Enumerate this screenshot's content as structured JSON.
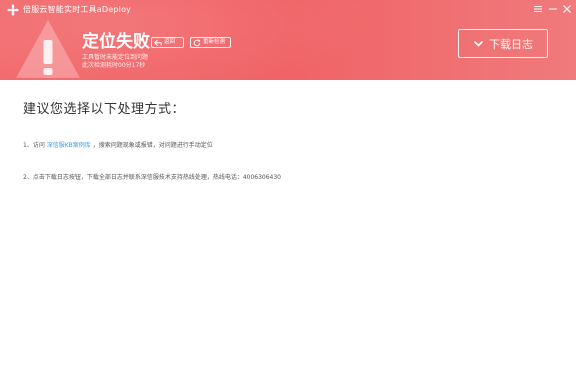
{
  "window": {
    "title": "倍服云智能实时工具aDeploy",
    "controls": [
      "menu-icon",
      "minimize-icon",
      "close-icon"
    ]
  },
  "status": {
    "title": "定位失败",
    "back_label": "返回",
    "retry_label": "重新检测",
    "line1": "工具暂时未能定位到问题",
    "line2": "此次检测耗时00分17秒"
  },
  "download": {
    "label": "下载日志"
  },
  "content": {
    "heading": "建议您选择以下处理方式：",
    "steps": [
      {
        "prefix": "1、访问",
        "link": "深信服KB案例库",
        "suffix": "，搜索问题现象或报错，对问题进行手动定位"
      },
      {
        "text": "2、点击下载日志按钮，下载全部日志并联系深信服技术支持热线处理，热线电话：4006306430"
      }
    ]
  },
  "colors": {
    "header": "#f06366",
    "link": "#3c9be0",
    "heading_text": "#333333",
    "body_text": "#555555"
  }
}
